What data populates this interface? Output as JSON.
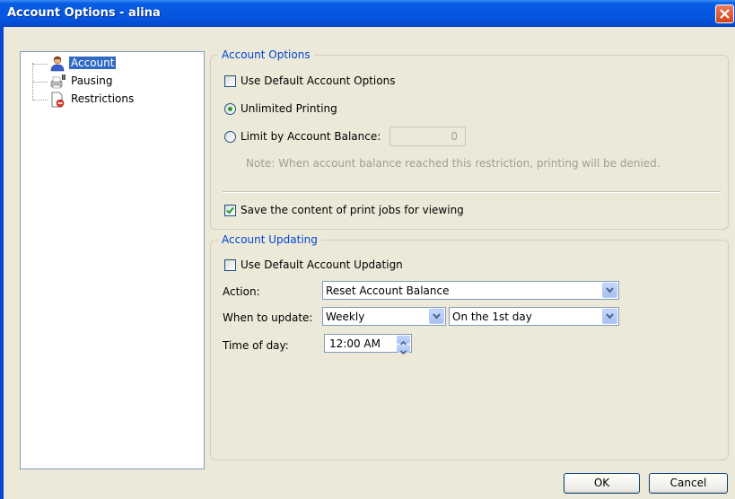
{
  "window": {
    "title": "Account Options - alina"
  },
  "tree": {
    "items": [
      {
        "label": "Account",
        "icon": "user-icon",
        "selected": true
      },
      {
        "label": "Pausing",
        "icon": "pause-printer-icon",
        "selected": false
      },
      {
        "label": "Restrictions",
        "icon": "restriction-document-icon",
        "selected": false
      }
    ]
  },
  "account_options": {
    "group_title": "Account Options",
    "use_default_label": "Use Default Account Options",
    "use_default_checked": false,
    "unlimited_label": "Unlimited Printing",
    "unlimited_selected": true,
    "limit_label": "Limit by Account Balance:",
    "limit_selected": false,
    "limit_value": "0",
    "note": "Note: When account balance reached this restriction, printing will be denied.",
    "save_content_label": "Save the content of print jobs for viewing",
    "save_content_checked": true
  },
  "account_updating": {
    "group_title": "Account Updating",
    "use_default_label": "Use Default Account Updatign",
    "use_default_checked": false,
    "action_label": "Action:",
    "action_value": "Reset Account Balance",
    "when_label": "When to update:",
    "when_value": "Weekly",
    "day_value": "On the 1st day",
    "time_label": "Time of day:",
    "time_value": "12:00 AM"
  },
  "buttons": {
    "ok": "OK",
    "cancel": "Cancel"
  },
  "colors": {
    "title_bar": "#0558df",
    "group_title": "#0046d5",
    "selection": "#316ac5",
    "dialog_bg": "#ece9d8"
  }
}
